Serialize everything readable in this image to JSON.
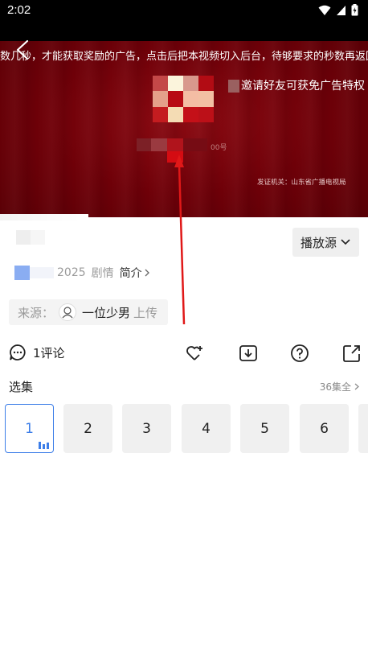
{
  "status_bar": {
    "time": "2:02"
  },
  "player": {
    "marquee_text": "数几秒，才能获取奖励的广告，点击后把本视频切入后台，待够要求的秒数再返回即",
    "qr_caption": "邀请好友可获免广告特权",
    "blurred_suffix": "00号",
    "certificate": "发证机关：山东省广播电视局"
  },
  "info": {
    "source_button": "播放源",
    "year": "2025",
    "genre": "剧情",
    "intro_link": "简介",
    "uploader_label": "来源：",
    "uploader_name": "一位少男",
    "uploader_suffix": "上传"
  },
  "actions": {
    "comment_count": "1评论",
    "icons": [
      "favorite-add-icon",
      "download-icon",
      "help-icon",
      "share-icon"
    ]
  },
  "episodes": {
    "header": "选集",
    "total_link": "36集全",
    "items": [
      "1",
      "2",
      "3",
      "4",
      "5",
      "6"
    ],
    "selected": "1"
  },
  "colors": {
    "accent": "#3d7ee8",
    "arrow": "#e01818",
    "video_bg": "#6e0008"
  }
}
